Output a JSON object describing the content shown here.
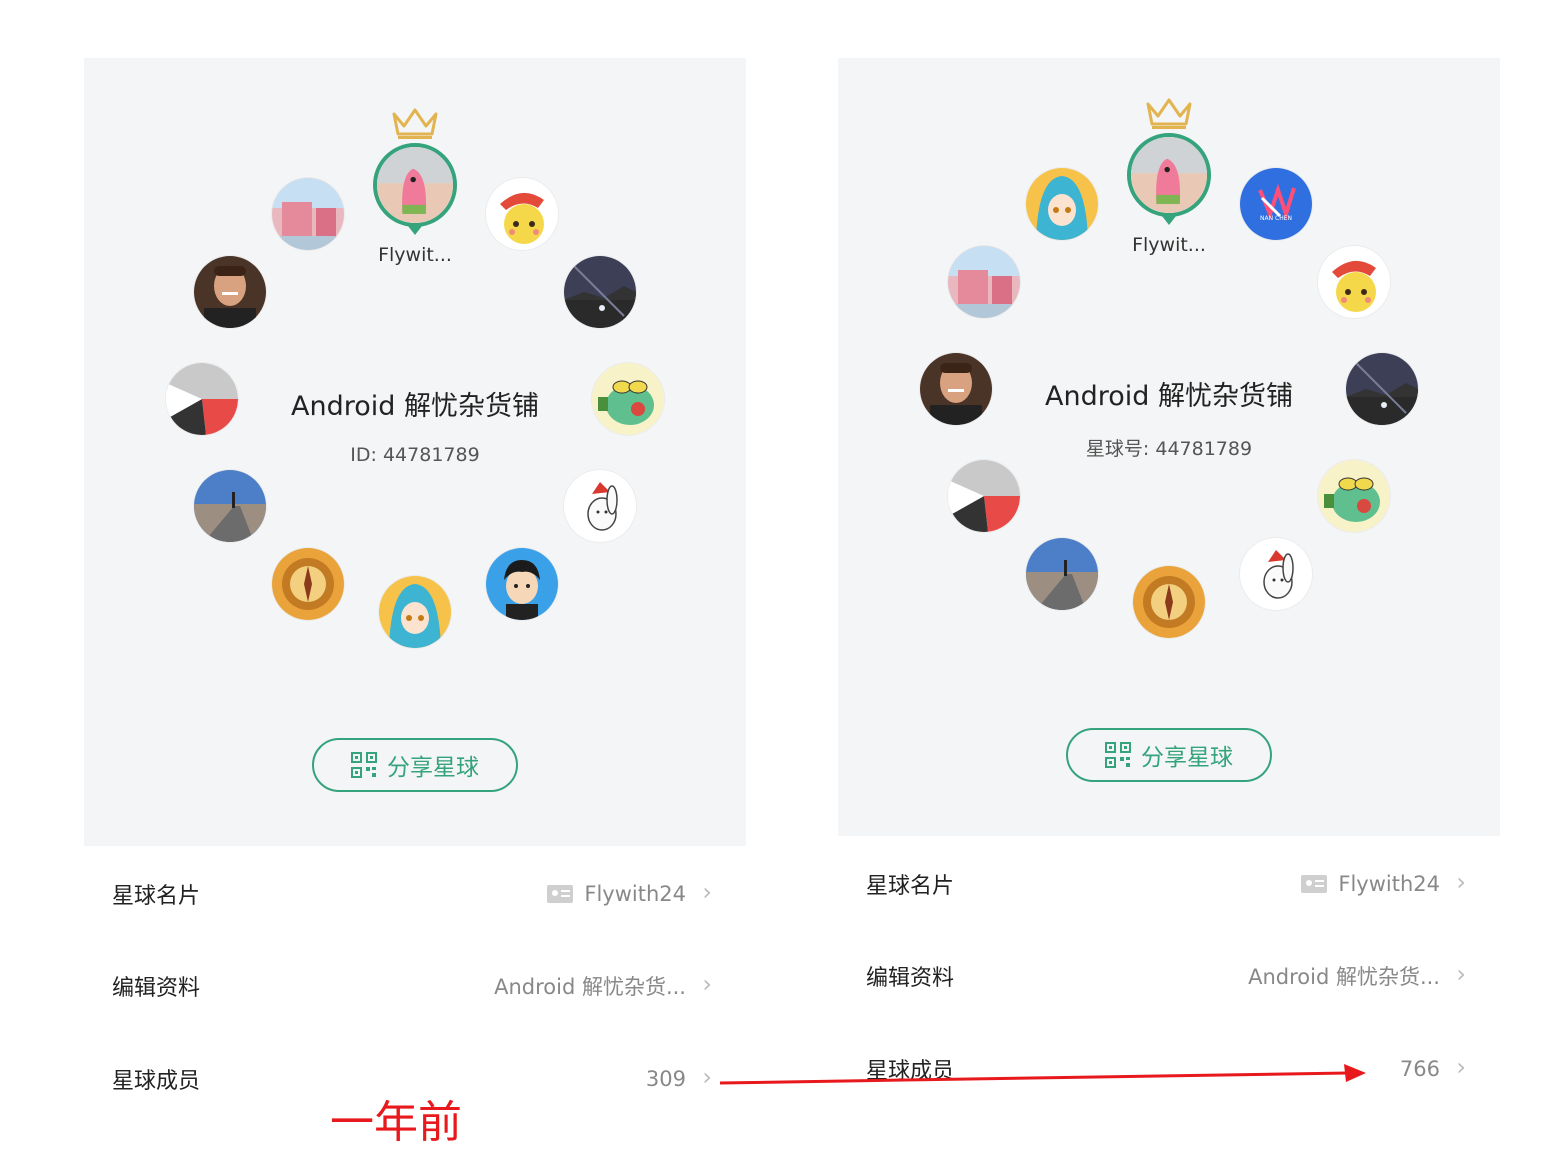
{
  "left": {
    "owner_name": "Flywit...",
    "title": "Android 解忧杂货铺",
    "id_text": "ID: 44781789",
    "share_label": "分享星球",
    "rows": [
      {
        "label": "星球名片",
        "value": "Flywith24"
      },
      {
        "label": "编辑资料",
        "value": "Android 解忧杂货..."
      },
      {
        "label": "星球成员",
        "value": "309"
      }
    ]
  },
  "right": {
    "owner_name": "Flywit...",
    "title": "Android 解忧杂货铺",
    "id_text": "星球号: 44781789",
    "share_label": "分享星球",
    "badge_text": "NAN CHEN",
    "rows": [
      {
        "label": "星球名片",
        "value": "Flywith24"
      },
      {
        "label": "编辑资料",
        "value": "Android 解忧杂货..."
      },
      {
        "label": "星球成员",
        "value": "766"
      }
    ]
  },
  "annotation": {
    "text": "一年前",
    "color": "#e8191c"
  },
  "colors": {
    "accent": "#35a37c",
    "crown": "#e2b450",
    "header_bg": "#f4f5f6"
  }
}
